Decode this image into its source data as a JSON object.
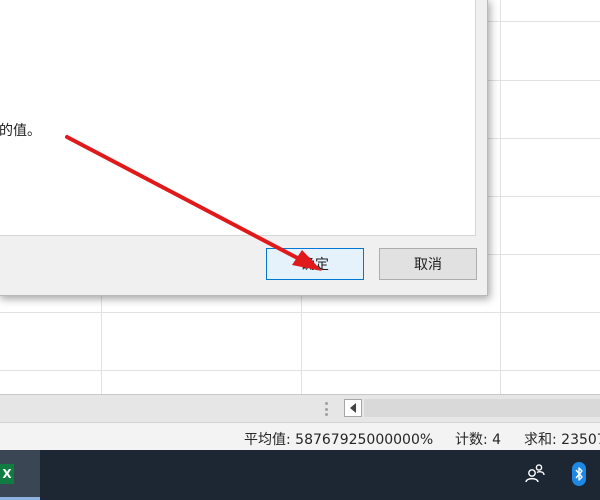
{
  "dialog": {
    "message_fragment": "的值。",
    "ok_label": "确定",
    "cancel_label": "取消"
  },
  "status_bar": {
    "average": "平均值: 58767925000000%",
    "count": "计数: 4",
    "sum": "求和: 23507"
  },
  "taskbar": {
    "excel_letter": "X",
    "icons": [
      "people-icon",
      "bluetooth-icon"
    ]
  },
  "colors": {
    "annotation_arrow": "#e0191b",
    "ok_border": "#0078d7",
    "taskbar_bg": "#1d2733",
    "excel_green": "#107c41"
  }
}
